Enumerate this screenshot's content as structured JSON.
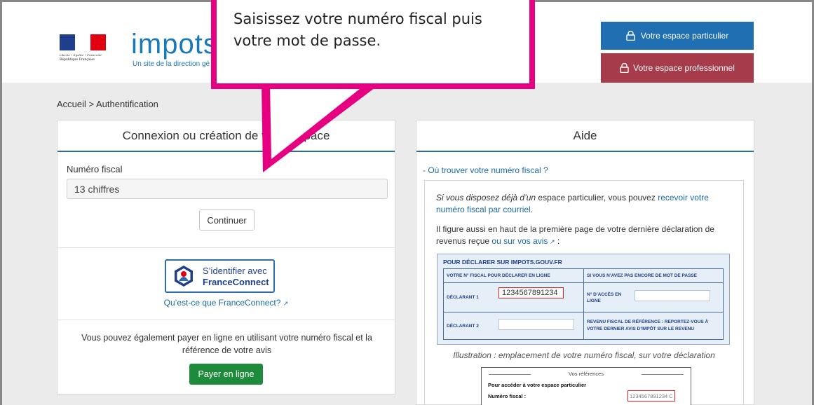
{
  "header": {
    "rf_motto": "Liberté • Égalité • Fraternité",
    "rf_name": "République Française",
    "brand": "impots",
    "brand_sub": "Un site de la direction gé",
    "btn_particulier": "Votre espace particulier",
    "btn_professionnel": "Votre espace professionnel",
    "colors": {
      "particulier": "#1f6fb2",
      "professionnel": "#a63b4c",
      "brand": "#1a7ab8"
    }
  },
  "breadcrumb": "Accueil  >  Authentification",
  "login": {
    "title": "Connexion ou création de votre espace",
    "field_label": "Numéro fiscal",
    "field_placeholder": "13 chiffres",
    "continue": "Continuer",
    "fc_line1": "S’identifier avec",
    "fc_line2": "FranceConnect",
    "fc_what": "Qu’est-ce que FranceConnect?",
    "pay_text": "Vous pouvez également payer en ligne en utilisant votre numéro fiscal et la référence de votre avis",
    "pay_button": "Payer en ligne"
  },
  "help": {
    "title": "Aide",
    "where_link": "- Où trouver votre numéro fiscal ?",
    "p1_italic": "Si vous disposez déjà d’un",
    "p1_rest": " espace particulier, vous pouvez ",
    "p1_link": "recevoir votre numéro fiscal par courriel",
    "p1_end": ".",
    "p2_text": "Il figure aussi en haut de la première page de votre dernière déclaration de revenus reçue ",
    "p2_link": "ou sur vos avis",
    "p2_end": " :",
    "form": {
      "head": "POUR DÉCLARER SUR IMPOTS.GOUV.FR",
      "col1": "VOTRE N° FISCAL POUR DÉCLARER EN LIGNE",
      "col2": "SI VOUS N’AVEZ PAS ENCORE DE MOT DE PASSE",
      "d1": "DÉCLARANT 1",
      "d1_number": "1234567891234",
      "access": "N° D’ACCÈS EN LIGNE",
      "d2": "DÉCLARANT 2",
      "rfr": "REVENU FISCAL DE RÉFÉRENCE : REPORTEZ-VOUS À VOTRE DERNIER AVIS D’IMPÔT SUR LE REVENU"
    },
    "caption": "Illustration : emplacement de votre numéro fiscal, sur votre déclaration",
    "refs": {
      "title": "Vos références",
      "l1": "Pour accéder à votre espace particulier",
      "l2": "Numéro fiscal :",
      "number": "1234567891234 C"
    }
  },
  "callout": {
    "text": "Saisissez votre numéro fiscal puis votre mot de passe.",
    "border_color": "#e60081"
  }
}
